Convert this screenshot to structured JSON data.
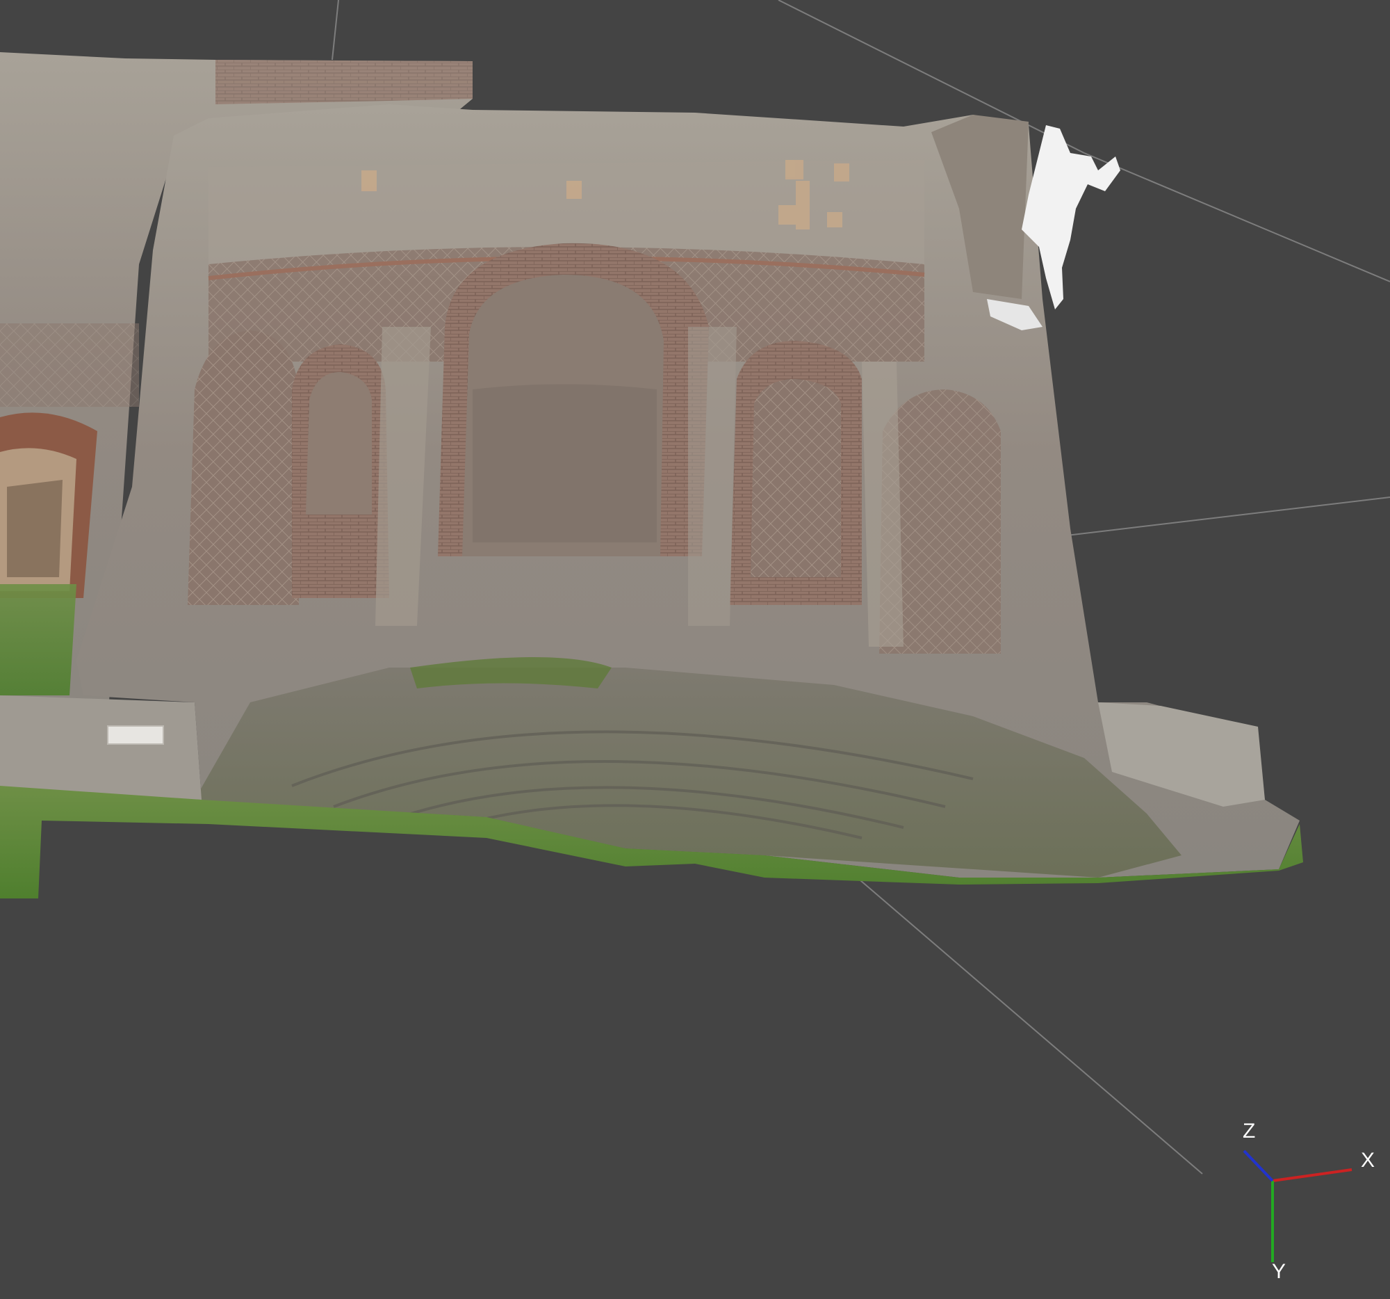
{
  "viewport": {
    "background": "#444444",
    "grid_line_color": "#8c8c8c"
  },
  "model": {
    "description_icon": "photogrammetry-ruin-model"
  },
  "axis_gizmo": {
    "x": {
      "label": "X",
      "color": "#cc2222"
    },
    "y": {
      "label": "Y",
      "color": "#22aa22"
    },
    "z": {
      "label": "Z",
      "color": "#2233cc"
    }
  }
}
